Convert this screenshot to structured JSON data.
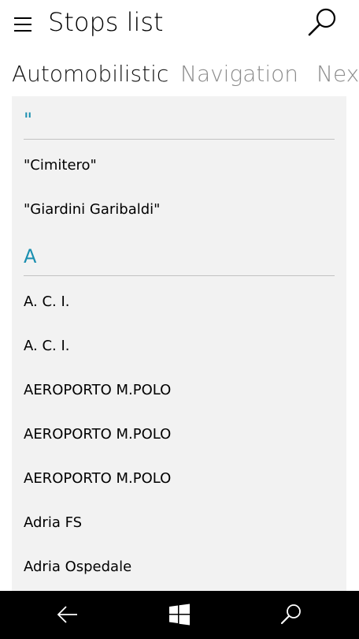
{
  "header": {
    "title": "Stops list",
    "menu_icon": "hamburger-menu-icon",
    "search_icon": "search-icon"
  },
  "pivot": {
    "tabs": [
      {
        "label": "Automobilistic",
        "active": true
      },
      {
        "label": "Navigation",
        "active": false
      },
      {
        "label": "Nex",
        "active": false
      }
    ]
  },
  "list": {
    "groups": [
      {
        "header": "\"",
        "items": [
          "\"Cimitero\"",
          "\"Giardini Garibaldi\""
        ]
      },
      {
        "header": "A",
        "items": [
          "A. C. I.",
          "A. C. I.",
          "AEROPORTO M.POLO",
          "AEROPORTO M.POLO",
          "AEROPORTO M.POLO",
          "Adria FS",
          "Adria Ospedale"
        ]
      }
    ]
  },
  "navbar": {
    "back_icon": "back-arrow-icon",
    "windows_icon": "windows-logo-icon",
    "search_icon": "search-icon"
  },
  "colors": {
    "accent": "#1a8fb0",
    "panel_bg": "#f2f2f2",
    "inactive_tab": "#8c8c8c",
    "navbar_bg": "#000000"
  }
}
